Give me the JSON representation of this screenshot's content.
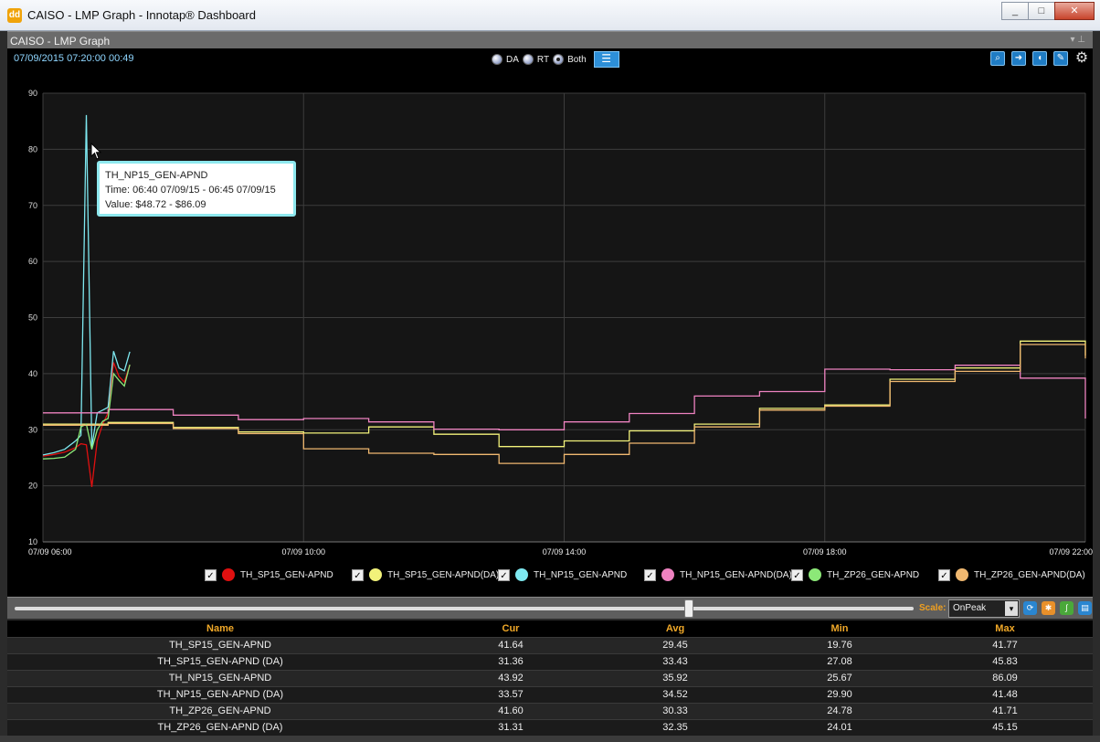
{
  "window": {
    "title": "CAISO - LMP Graph - Innotap® Dashboard",
    "app_icon": "dd",
    "minimize": "_",
    "maximize": "□",
    "close": "✕"
  },
  "panel": {
    "title": "CAISO - LMP Graph",
    "pins": "▾ ⊥"
  },
  "header": {
    "datetime": "07/09/2015 07:20:00  00:49",
    "modes": [
      {
        "label": "DA",
        "selected": false
      },
      {
        "label": "RT",
        "selected": false
      },
      {
        "label": "Both",
        "selected": true
      }
    ],
    "list_icon": "☰"
  },
  "tools": [
    {
      "name": "zoom-icon",
      "glyph": "⌕"
    },
    {
      "name": "forward-icon",
      "glyph": "➜"
    },
    {
      "name": "sound-icon",
      "glyph": "◖"
    },
    {
      "name": "chart-icon",
      "glyph": "✎"
    },
    {
      "name": "gear-icon",
      "glyph": "⚙"
    }
  ],
  "chart_data": {
    "type": "line",
    "title": "",
    "xlabel": "",
    "ylabel": "",
    "ylim": [
      10,
      90
    ],
    "y_ticks": [
      "10",
      "20",
      "30",
      "40",
      "50",
      "60",
      "70",
      "80",
      "90"
    ],
    "xlim": [
      "06:00",
      "22:00"
    ],
    "x_ticks": [
      "07/09 06:00",
      "07/09 10:00",
      "07/09 14:00",
      "07/09 18:00",
      "07/09 22:00"
    ],
    "grid": true,
    "series": [
      {
        "name": "TH_SP15_GEN-APND",
        "color": "#e01010",
        "step": false,
        "points": [
          [
            "06:00",
            25.3
          ],
          [
            "06:10",
            25.6
          ],
          [
            "06:20",
            26
          ],
          [
            "06:30",
            26.8
          ],
          [
            "06:35",
            27.5
          ],
          [
            "06:40",
            27.3
          ],
          [
            "06:45",
            19.8
          ],
          [
            "06:50",
            28
          ],
          [
            "06:55",
            31
          ],
          [
            "07:00",
            33
          ],
          [
            "07:05",
            42
          ],
          [
            "07:10",
            39.5
          ],
          [
            "07:15",
            38.5
          ],
          [
            "07:20",
            41.6
          ]
        ]
      },
      {
        "name": "TH_SP15_GEN-APND(DA)",
        "color": "#f2f27a",
        "step": true,
        "points": [
          [
            "06:00",
            31
          ],
          [
            "07:00",
            31.3
          ],
          [
            "08:00",
            30.4
          ],
          [
            "09:00",
            29.6
          ],
          [
            "10:00",
            29.4
          ],
          [
            "11:00",
            30.5
          ],
          [
            "12:00",
            29.2
          ],
          [
            "13:00",
            27
          ],
          [
            "14:00",
            28
          ],
          [
            "15:00",
            29.8
          ],
          [
            "16:00",
            31
          ],
          [
            "17:00",
            33.8
          ],
          [
            "18:00",
            34.4
          ],
          [
            "19:00",
            39
          ],
          [
            "20:00",
            41
          ],
          [
            "21:00",
            45.8
          ],
          [
            "22:00",
            43.2
          ]
        ]
      },
      {
        "name": "TH_NP15_GEN-APND",
        "color": "#7ee8f0",
        "step": false,
        "points": [
          [
            "06:00",
            25.5
          ],
          [
            "06:10",
            25.9
          ],
          [
            "06:20",
            26.5
          ],
          [
            "06:30",
            28
          ],
          [
            "06:35",
            29
          ],
          [
            "06:40",
            86.1
          ],
          [
            "06:45",
            27
          ],
          [
            "06:50",
            33
          ],
          [
            "06:55",
            33.5
          ],
          [
            "07:00",
            34
          ],
          [
            "07:05",
            44
          ],
          [
            "07:10",
            41
          ],
          [
            "07:15",
            40.5
          ],
          [
            "07:20",
            43.9
          ]
        ]
      },
      {
        "name": "TH_NP15_GEN-APND(DA)",
        "color": "#ee82c0",
        "step": true,
        "points": [
          [
            "06:00",
            33
          ],
          [
            "07:00",
            33.6
          ],
          [
            "08:00",
            32.6
          ],
          [
            "09:00",
            31.8
          ],
          [
            "10:00",
            32
          ],
          [
            "11:00",
            31.4
          ],
          [
            "12:00",
            30.1
          ],
          [
            "13:00",
            30
          ],
          [
            "14:00",
            31.4
          ],
          [
            "15:00",
            32.9
          ],
          [
            "16:00",
            36
          ],
          [
            "17:00",
            36.8
          ],
          [
            "18:00",
            40.8
          ],
          [
            "19:00",
            40.7
          ],
          [
            "20:00",
            41.5
          ],
          [
            "21:00",
            39.2
          ],
          [
            "22:00",
            32
          ]
        ]
      },
      {
        "name": "TH_ZP26_GEN-APND",
        "color": "#8ce878",
        "step": false,
        "points": [
          [
            "06:00",
            24.8
          ],
          [
            "06:10",
            24.9
          ],
          [
            "06:20",
            25.1
          ],
          [
            "06:30",
            26.5
          ],
          [
            "06:35",
            30.5
          ],
          [
            "06:40",
            31
          ],
          [
            "06:45",
            26.5
          ],
          [
            "06:50",
            30
          ],
          [
            "06:55",
            31.5
          ],
          [
            "07:00",
            32
          ],
          [
            "07:05",
            40
          ],
          [
            "07:10",
            38.8
          ],
          [
            "07:15",
            37.8
          ],
          [
            "07:20",
            41.6
          ]
        ]
      },
      {
        "name": "TH_ZP26_GEN-APND(DA)",
        "color": "#f0b870",
        "step": true,
        "points": [
          [
            "06:00",
            30.8
          ],
          [
            "07:00",
            31.1
          ],
          [
            "08:00",
            30.2
          ],
          [
            "09:00",
            29.3
          ],
          [
            "10:00",
            26.6
          ],
          [
            "11:00",
            25.8
          ],
          [
            "12:00",
            25.6
          ],
          [
            "13:00",
            24
          ],
          [
            "14:00",
            25.6
          ],
          [
            "15:00",
            27.6
          ],
          [
            "16:00",
            30.5
          ],
          [
            "17:00",
            33.5
          ],
          [
            "18:00",
            34.2
          ],
          [
            "19:00",
            38.6
          ],
          [
            "20:00",
            40.4
          ],
          [
            "21:00",
            45.2
          ],
          [
            "22:00",
            42.7
          ]
        ]
      }
    ]
  },
  "tooltip": {
    "series": "TH_NP15_GEN-APND",
    "time": "Time: 06:40 07/09/15 - 06:45 07/09/15",
    "value": "Value: $48.72 - $86.09"
  },
  "legend": [
    {
      "label": "TH_SP15_GEN-APND",
      "color": "#e01010"
    },
    {
      "label": "TH_SP15_GEN-APND(DA)",
      "color": "#f2f27a"
    },
    {
      "label": "TH_NP15_GEN-APND",
      "color": "#7ee8f0"
    },
    {
      "label": "TH_NP15_GEN-APND(DA)",
      "color": "#ee82c0"
    },
    {
      "label": "TH_ZP26_GEN-APND",
      "color": "#8ce878"
    },
    {
      "label": "TH_ZP26_GEN-APND(DA)",
      "color": "#f0b870"
    }
  ],
  "check_mark": "✓",
  "slider": {
    "position": 0.75,
    "scale_label": "Scale:",
    "scale_value": "OnPeak",
    "arrow": "▾"
  },
  "slider_buttons": [
    {
      "name": "refresh-icon",
      "color": "#2a86d0",
      "glyph": "⟳"
    },
    {
      "name": "settings-icon",
      "color": "#e8902a",
      "glyph": "✱"
    },
    {
      "name": "line-icon",
      "color": "#4aa83a",
      "glyph": "∫"
    },
    {
      "name": "save-icon",
      "color": "#2a86d0",
      "glyph": "▤"
    }
  ],
  "table": {
    "headers": [
      "Name",
      "Cur",
      "Avg",
      "Min",
      "Max"
    ],
    "rows": [
      [
        "TH_SP15_GEN-APND",
        "41.64",
        "29.45",
        "19.76",
        "41.77"
      ],
      [
        "TH_SP15_GEN-APND (DA)",
        "31.36",
        "33.43",
        "27.08",
        "45.83"
      ],
      [
        "TH_NP15_GEN-APND",
        "43.92",
        "35.92",
        "25.67",
        "86.09"
      ],
      [
        "TH_NP15_GEN-APND (DA)",
        "33.57",
        "34.52",
        "29.90",
        "41.48"
      ],
      [
        "TH_ZP26_GEN-APND",
        "41.60",
        "30.33",
        "24.78",
        "41.71"
      ],
      [
        "TH_ZP26_GEN-APND (DA)",
        "31.31",
        "32.35",
        "24.01",
        "45.15"
      ]
    ]
  }
}
